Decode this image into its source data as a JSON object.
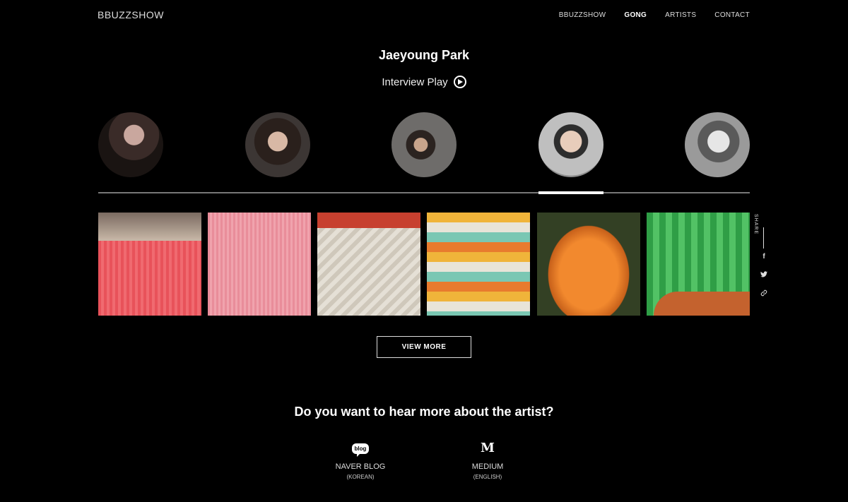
{
  "header": {
    "logo": "BBUZZSHOW",
    "nav": [
      "BBUZZSHOW",
      "GONG",
      "ARTISTS",
      "CONTACT"
    ],
    "active_nav": "GONG"
  },
  "artist": {
    "name": "Jaeyoung Park",
    "interview_label": "Interview Play"
  },
  "carousel": {
    "avatar_count": 5,
    "active_index": 3
  },
  "gallery": {
    "image_count": 6
  },
  "share": {
    "label": "SHARE",
    "icons": [
      "facebook-icon",
      "twitter-icon",
      "link-icon"
    ]
  },
  "view_more_label": "VIEW MORE",
  "footer": {
    "heading": "Do you want to hear more about the artist?",
    "links": [
      {
        "icon_text": "blog",
        "title": "NAVER BLOG",
        "sub": "(KOREAN)"
      },
      {
        "icon_text": "M",
        "title": "MEDIUM",
        "sub": "(ENGLISH)"
      }
    ]
  },
  "colors": {
    "background": "#000000",
    "text": "#ffffff",
    "track": "#777777"
  }
}
